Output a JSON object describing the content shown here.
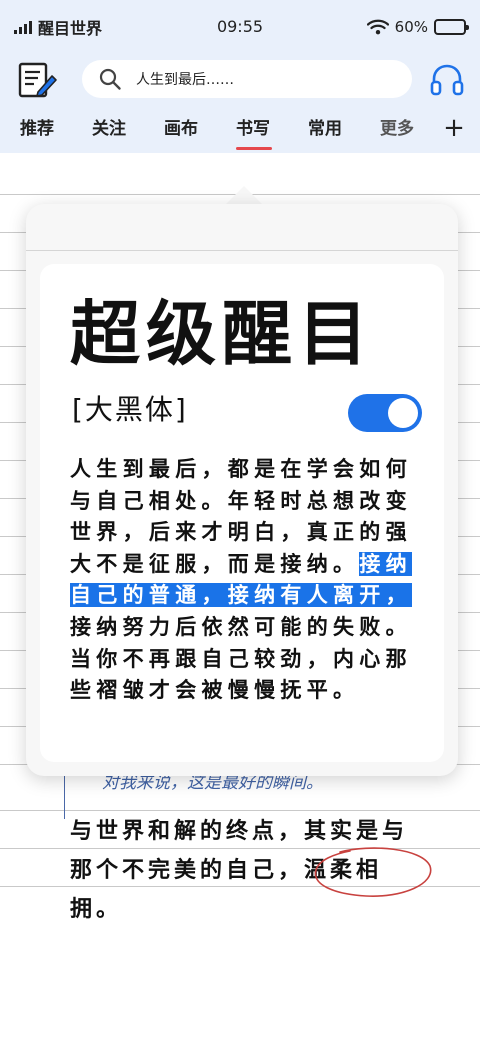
{
  "status_bar": {
    "carrier": "醒目世界",
    "time": "09:55",
    "battery_percent": 60,
    "battery_label": "60%"
  },
  "search": {
    "value": "人生到最后……"
  },
  "tabs": [
    {
      "label": "推荐"
    },
    {
      "label": "关注"
    },
    {
      "label": "画布"
    },
    {
      "label": "书写",
      "active": true
    },
    {
      "label": "常用"
    },
    {
      "label": "更多"
    }
  ],
  "add_label": "+",
  "popover": {
    "title": "超级醒目",
    "font_name": "[大黑体]",
    "toggle_on": true,
    "text_before": "人生到最后，都是在学会如何与自己相处。年轻时总想改变世界，后来才明白，真正的强大不是征服，而是接纳。",
    "text_highlight": "接纳自己的普通，接纳有人离开，",
    "text_after": "接纳努力后依然可能的失败。当你不再跟自己较劲，内心那些褶皱才会被慢慢抚平。"
  },
  "note": {
    "handwriting": "对我来说，这是最好的瞬间。",
    "text": "与世界和解的终点，其实是与那个不完美的自己，温柔相拥。"
  },
  "colors": {
    "accent_blue": "#1f72e8",
    "tab_indicator": "#e5484d",
    "header_bg": "#e9f0fb",
    "handwriting_blue": "#4163a6",
    "annotation_red": "#c8423f"
  }
}
